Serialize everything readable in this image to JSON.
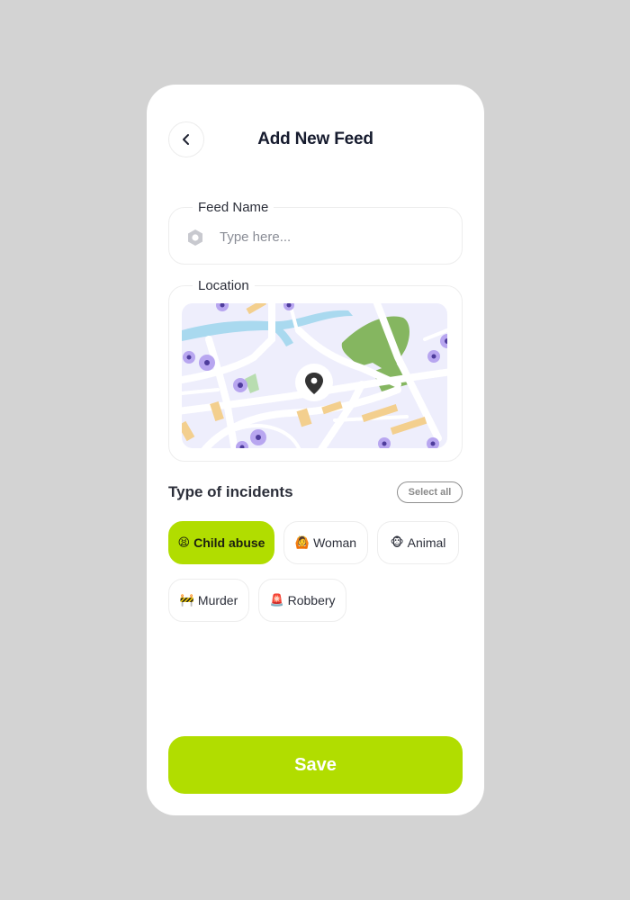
{
  "header": {
    "title": "Add New Feed",
    "back_icon": "chevron-left-icon"
  },
  "feed_name": {
    "label": "Feed Name",
    "placeholder": "Type here...",
    "value": "",
    "icon": "hexagon-icon"
  },
  "location": {
    "label": "Location",
    "pin_icon": "location-pin-icon"
  },
  "incidents": {
    "title": "Type of incidents",
    "select_all_label": "Select all",
    "items": [
      {
        "emoji": "😫",
        "label": "Child abuse",
        "selected": true
      },
      {
        "emoji": "🙆",
        "label": "Woman",
        "selected": false
      },
      {
        "emoji": "🐵",
        "label": "Animal",
        "selected": false
      },
      {
        "emoji": "🚧",
        "label": "Murder",
        "selected": false
      },
      {
        "emoji": "🚨",
        "label": "Robbery",
        "selected": false
      }
    ]
  },
  "footer": {
    "save_label": "Save"
  },
  "colors": {
    "accent": "#b1dd00",
    "background": "#d3d3d3",
    "card": "#ffffff",
    "text": "#161b2e"
  }
}
